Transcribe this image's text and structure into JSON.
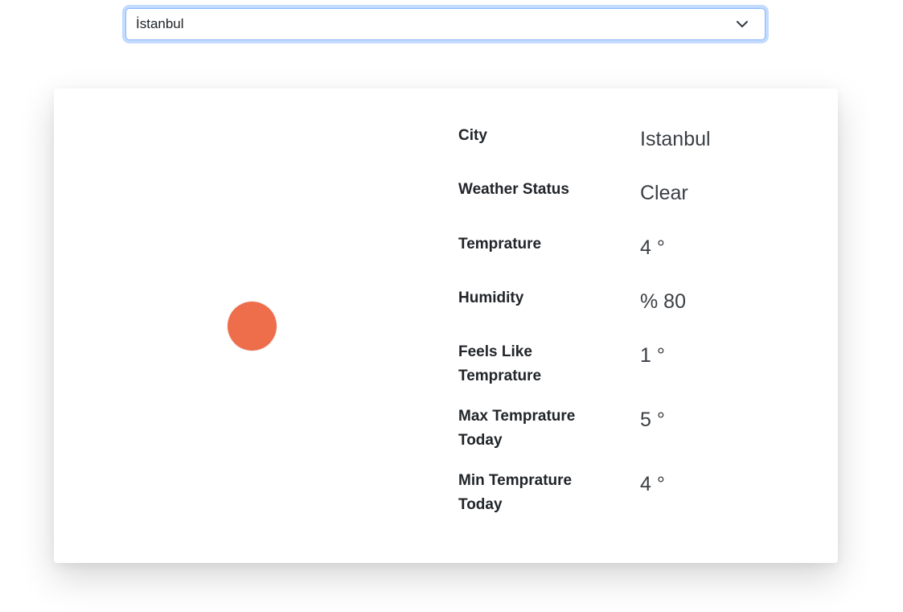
{
  "select": {
    "selected_value": "İstanbul"
  },
  "weather": {
    "icon": "weather-status-circle-icon",
    "icon_color": "#ee6e4c",
    "rows": [
      {
        "label": "City",
        "value": "Istanbul"
      },
      {
        "label": "Weather Status",
        "value": "Clear"
      },
      {
        "label": "Temprature",
        "value": "4 °"
      },
      {
        "label": "Humidity",
        "value": "% 80"
      },
      {
        "label": "Feels Like Temprature",
        "value": "1 °"
      },
      {
        "label": "Max Temprature Today",
        "value": "5 °"
      },
      {
        "label": "Min Temprature Today",
        "value": "4 °"
      }
    ]
  }
}
